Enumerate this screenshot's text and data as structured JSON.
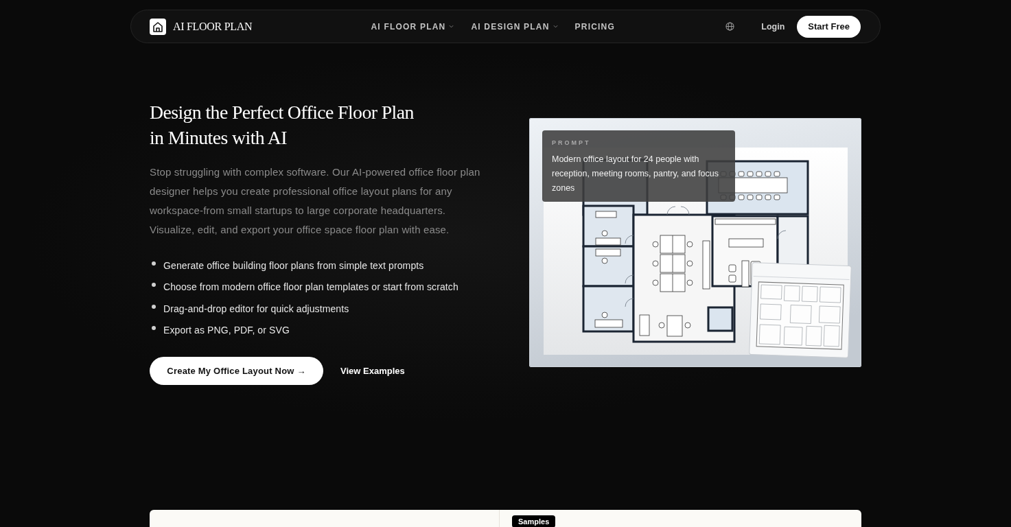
{
  "nav": {
    "logo_text": "AI FLOOR PLAN",
    "links": [
      {
        "label": "AI FLOOR PLAN",
        "dropdown": true
      },
      {
        "label": "AI DESIGN PLAN",
        "dropdown": true
      },
      {
        "label": "PRICING",
        "dropdown": false
      }
    ],
    "login": "Login",
    "cta": "Start Free"
  },
  "hero": {
    "title_lines": [
      "Design the Perfect Office Floor Plan",
      "in Minutes with AI"
    ],
    "description": "Stop struggling with complex software. Our AI-powered office floor plan designer helps you create professional office layout plans for any workspace-from small startups to large corporate headquarters. Visualize, edit, and export your office space floor plan with ease.",
    "features": [
      "Generate office building floor plans from simple text prompts",
      "Choose from modern office floor plan templates or start from scratch",
      "Drag-and-drop editor for quick adjustments",
      "Export as PNG, PDF, or SVG"
    ],
    "primary_button": "Create My Office Layout Now →",
    "secondary_link": "View Examples",
    "prompt_card": {
      "label": "PROMPT",
      "text": "Modern office layout for 24 people with reception, meeting rooms, pantry, and focus zones"
    }
  },
  "samples_section": {
    "badge": "Samples"
  }
}
